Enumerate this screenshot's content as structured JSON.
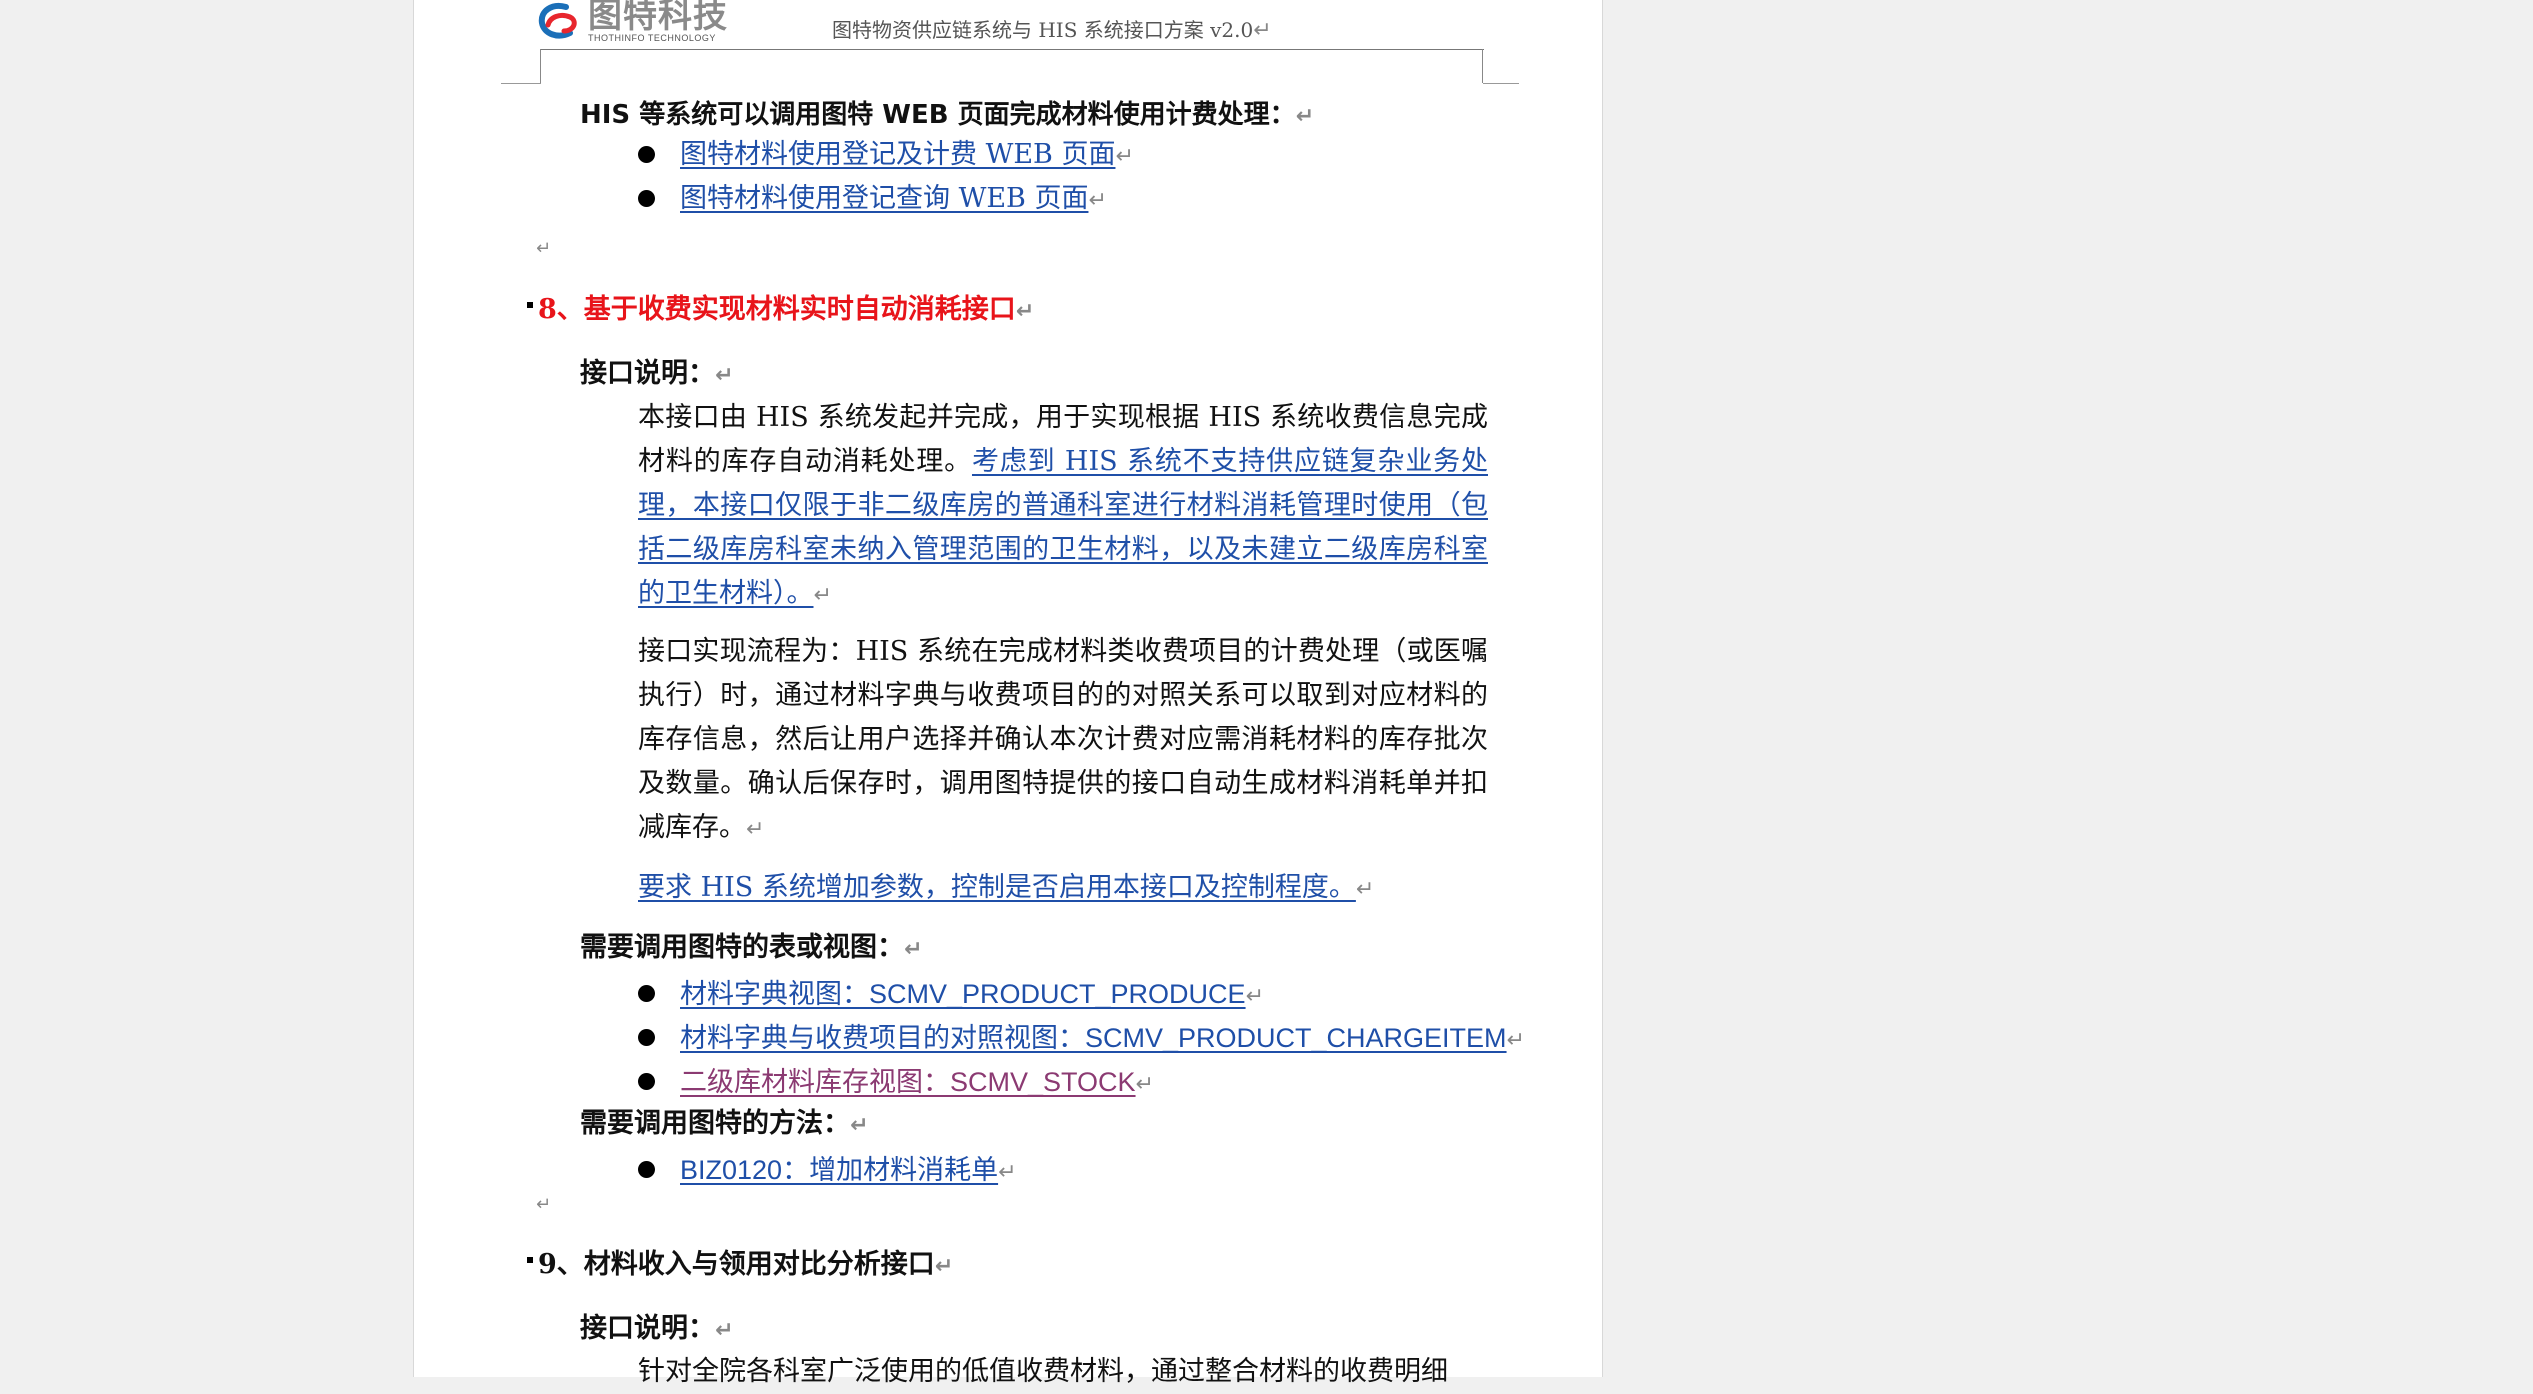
{
  "header": {
    "logo_cn": "图特科技",
    "logo_en": "THOTHINFO TECHNOLOGY",
    "title": "图特物资供应链系统与 HIS 系统接口方案 v2.0"
  },
  "intro": {
    "line": "HIS 等系统可以调用图特 WEB 页面完成材料使用计费处理：",
    "links": [
      "图特材料使用登记及计费 WEB 页面",
      "图特材料使用登记查询 WEB 页面"
    ]
  },
  "section8": {
    "heading": "8、基于收费实现材料实时自动消耗接口",
    "desc_label": "接口说明：",
    "para1_plain": "本接口由 HIS 系统发起并完成，用于实现根据 HIS 系统收费信息完成材料的库存自动消耗处理。",
    "para1_link": "考虑到 HIS 系统不支持供应链复杂业务处理，本接口仅限于非二级库房的普通科室进行材料消耗管理时使用（包括二级库房科室未纳入管理范围的卫生材料，以及未建立二级库房科室的卫生材料）。",
    "para2": "接口实现流程为：HIS 系统在完成材料类收费项目的计费处理（或医嘱执行）时，通过材料字典与收费项目的的对照关系可以取到对应材料的库存信息，然后让用户选择并确认本次计费对应需消耗材料的库存批次及数量。确认后保存时，调用图特提供的接口自动生成材料消耗单并扣减库存。",
    "para3_link": "要求 HIS 系统增加参数，控制是否启用本接口及控制程度。",
    "tables_label": "需要调用图特的表或视图：",
    "tables": [
      "材料字典视图：SCMV_PRODUCT_PRODUCE",
      "材料字典与收费项目的对照视图：SCMV_PRODUCT_CHARGEITEM",
      "二级库材料库存视图：SCMV_STOCK"
    ],
    "methods_label": "需要调用图特的方法：",
    "methods": [
      "BIZ0120：增加材料消耗单"
    ]
  },
  "section9": {
    "heading": "9、材料收入与领用对比分析接口",
    "desc_label": "接口说明：",
    "para1_partial": "针对全院各科室广泛使用的低值收费材料，通过整合材料的收费明细"
  },
  "colors": {
    "link": "#1f4fa8",
    "visited": "#8b3a72",
    "heading_red": "#e8141a"
  }
}
